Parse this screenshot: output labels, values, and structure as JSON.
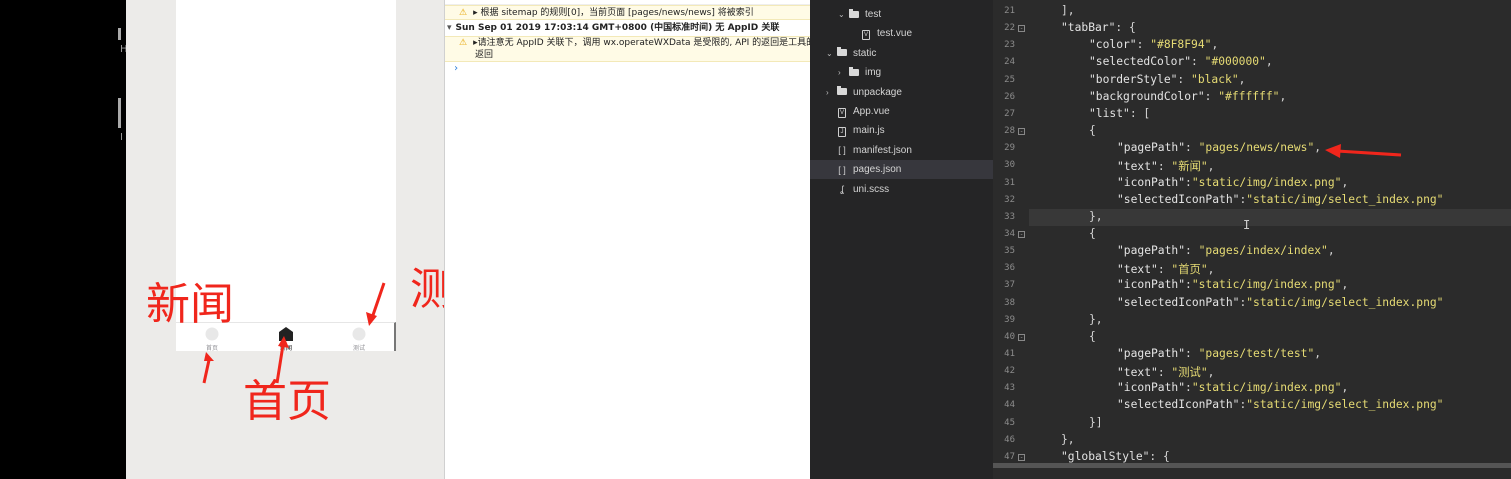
{
  "left_strip": {
    "labels": [
      "H",
      "I",
      "I"
    ]
  },
  "simulator": {
    "tabbar": {
      "tabs": [
        {
          "label": "首页",
          "icon": "home-placeholder-icon",
          "selected": false
        },
        {
          "label": "新闻",
          "icon": "house-icon",
          "selected": true
        },
        {
          "label": "测试",
          "icon": "home-placeholder-icon",
          "selected": false
        }
      ]
    },
    "annotations": {
      "news": "新闻",
      "home": "首页",
      "test": "测试"
    }
  },
  "console": {
    "lines": [
      {
        "type": "warn",
        "text": "▸ 根据 sitemap 的规则[0]，当前页面 [pages/news/news] 将被索引"
      },
      {
        "type": "header",
        "text": "Sun Sep 01 2019 17:03:14 GMT+0800 (中国标准时间) 无 AppID 关联"
      },
      {
        "type": "warn",
        "text": "▸请注意无 AppID 关联下，调用 wx.operateWXData 是受限的, API 的返回是工具的模拟"
      },
      {
        "type": "plain",
        "text": "返回"
      }
    ],
    "prompt": "›"
  },
  "explorer": {
    "items": [
      {
        "label": "test",
        "kind": "folder",
        "expanded": true,
        "indent": 2
      },
      {
        "label": "test.vue",
        "kind": "vue",
        "indent": 3
      },
      {
        "label": "static",
        "kind": "folder",
        "expanded": true,
        "indent": 1
      },
      {
        "label": "img",
        "kind": "folder",
        "expanded": false,
        "indent": 2
      },
      {
        "label": "unpackage",
        "kind": "folder",
        "expanded": false,
        "indent": 1
      },
      {
        "label": "App.vue",
        "kind": "vue",
        "indent": 1
      },
      {
        "label": "main.js",
        "kind": "js",
        "indent": 1
      },
      {
        "label": "manifest.json",
        "kind": "json",
        "indent": 1
      },
      {
        "label": "pages.json",
        "kind": "json",
        "indent": 1,
        "active": true
      },
      {
        "label": "uni.scss",
        "kind": "scss",
        "indent": 1
      }
    ]
  },
  "editor": {
    "lines": [
      {
        "n": "21",
        "fold": "",
        "indent": 1,
        "text": "],",
        "kind": "p"
      },
      {
        "n": "22",
        "fold": "-",
        "indent": 1,
        "text": "\"tabBar\": {",
        "kind": "kv0"
      },
      {
        "n": "23",
        "fold": "",
        "indent": 2,
        "text": "\"color\": \"#8F8F94\",",
        "kind": "kv"
      },
      {
        "n": "24",
        "fold": "",
        "indent": 2,
        "text": "\"selectedColor\": \"#000000\",",
        "kind": "kv"
      },
      {
        "n": "25",
        "fold": "",
        "indent": 2,
        "text": "\"borderStyle\": \"black\",",
        "kind": "kv"
      },
      {
        "n": "26",
        "fold": "",
        "indent": 2,
        "text": "\"backgroundColor\": \"#ffffff\",",
        "kind": "kv"
      },
      {
        "n": "27",
        "fold": "",
        "indent": 2,
        "text": "\"list\": [",
        "kind": "kv0"
      },
      {
        "n": "28",
        "fold": "-",
        "indent": 2,
        "text": "{",
        "kind": "p"
      },
      {
        "n": "29",
        "fold": "",
        "indent": 3,
        "text": "\"pagePath\": \"pages/news/news\",",
        "kind": "kv"
      },
      {
        "n": "30",
        "fold": "",
        "indent": 3,
        "text": "\"text\": \"新闻\",",
        "kind": "kv"
      },
      {
        "n": "31",
        "fold": "",
        "indent": 3,
        "text": "\"iconPath\":\"static/img/index.png\",",
        "kind": "kv"
      },
      {
        "n": "32",
        "fold": "",
        "indent": 3,
        "text": "\"selectedIconPath\":\"static/img/select_index.png\"",
        "kind": "kv"
      },
      {
        "n": "33",
        "fold": "",
        "indent": 2,
        "text": "},",
        "kind": "p"
      },
      {
        "n": "34",
        "fold": "-",
        "indent": 2,
        "text": "{",
        "kind": "p"
      },
      {
        "n": "35",
        "fold": "",
        "indent": 3,
        "text": "\"pagePath\": \"pages/index/index\",",
        "kind": "kv"
      },
      {
        "n": "36",
        "fold": "",
        "indent": 3,
        "text": "\"text\": \"首页\",",
        "kind": "kv"
      },
      {
        "n": "37",
        "fold": "",
        "indent": 3,
        "text": "\"iconPath\":\"static/img/index.png\",",
        "kind": "kv"
      },
      {
        "n": "38",
        "fold": "",
        "indent": 3,
        "text": "\"selectedIconPath\":\"static/img/select_index.png\"",
        "kind": "kv"
      },
      {
        "n": "39",
        "fold": "",
        "indent": 2,
        "text": "},",
        "kind": "p"
      },
      {
        "n": "40",
        "fold": "-",
        "indent": 2,
        "text": "{",
        "kind": "p"
      },
      {
        "n": "41",
        "fold": "",
        "indent": 3,
        "text": "\"pagePath\": \"pages/test/test\",",
        "kind": "kv"
      },
      {
        "n": "42",
        "fold": "",
        "indent": 3,
        "text": "\"text\": \"测试\",",
        "kind": "kv"
      },
      {
        "n": "43",
        "fold": "",
        "indent": 3,
        "text": "\"iconPath\":\"static/img/index.png\",",
        "kind": "kv"
      },
      {
        "n": "44",
        "fold": "",
        "indent": 3,
        "text": "\"selectedIconPath\":\"static/img/select_index.png\"",
        "kind": "kv"
      },
      {
        "n": "45",
        "fold": "",
        "indent": 2,
        "text": "}]",
        "kind": "p"
      },
      {
        "n": "46",
        "fold": "",
        "indent": 1,
        "text": "},",
        "kind": "p"
      },
      {
        "n": "47",
        "fold": "-",
        "indent": 1,
        "text": "\"globalStyle\": {",
        "kind": "kv0"
      }
    ],
    "colors": {
      "string": "#e6db74",
      "key": "#e3e3e3",
      "punct": "#d4d4d4",
      "arrow": "#f0261c"
    }
  }
}
